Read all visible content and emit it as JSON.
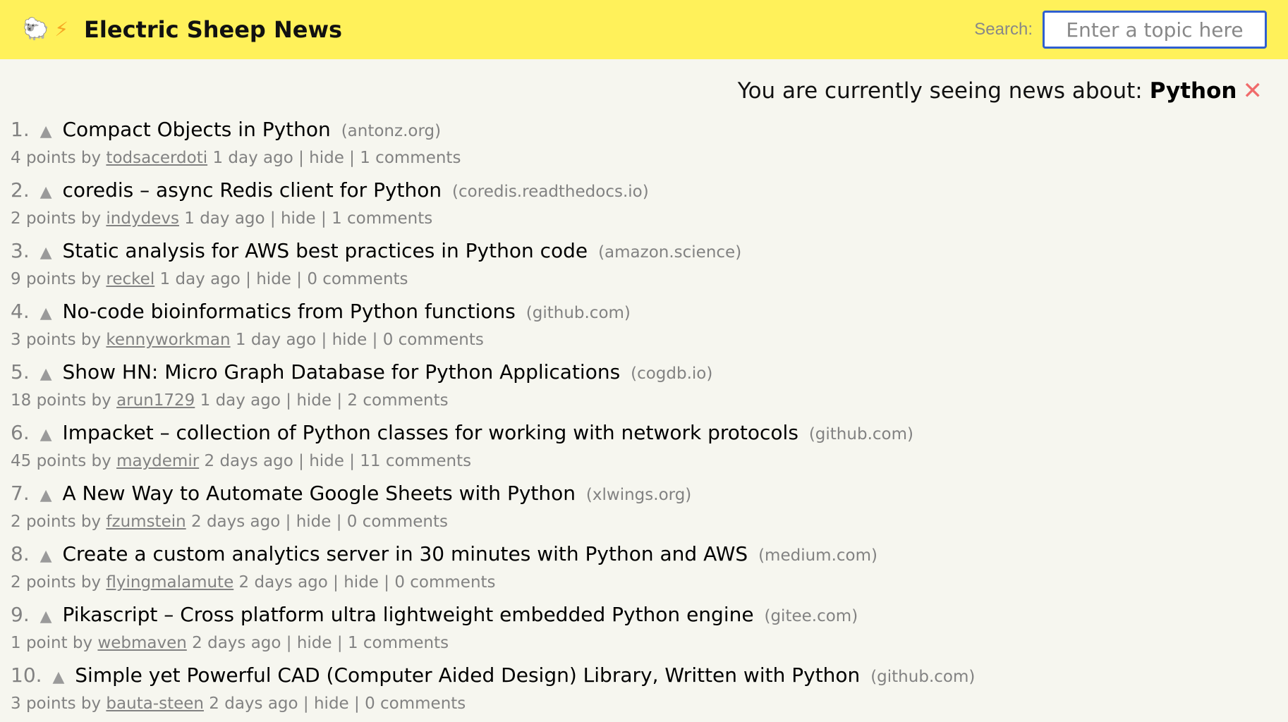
{
  "header": {
    "site_title": "Electric Sheep News",
    "icons": [
      "sheep-icon",
      "lightning-bolt-icon"
    ],
    "background_color": "#fff15a",
    "search_label": "Search:",
    "search_placeholder": "Enter a topic here"
  },
  "topic": {
    "prefix": "You are currently seeing news about:",
    "name": "Python",
    "close_icon": "close-icon",
    "close_color": "#f06b6b"
  },
  "stories": [
    {
      "rank": "1.",
      "title": "Compact Objects in Python",
      "domain": "(antonz.org)",
      "points": "4 points by",
      "author": "todsacerdoti",
      "age": "1 day ago",
      "hide": "hide",
      "comments": "1 comments"
    },
    {
      "rank": "2.",
      "title": "coredis – async Redis client for Python",
      "domain": "(coredis.readthedocs.io)",
      "points": "2 points by",
      "author": "indydevs",
      "age": "1 day ago",
      "hide": "hide",
      "comments": "1 comments"
    },
    {
      "rank": "3.",
      "title": "Static analysis for AWS best practices in Python code",
      "domain": "(amazon.science)",
      "points": "9 points by",
      "author": "reckel",
      "age": "1 day ago",
      "hide": "hide",
      "comments": "0 comments"
    },
    {
      "rank": "4.",
      "title": "No-code bioinformatics from Python functions",
      "domain": "(github.com)",
      "points": "3 points by",
      "author": "kennyworkman",
      "age": "1 day ago",
      "hide": "hide",
      "comments": "0 comments"
    },
    {
      "rank": "5.",
      "title": "Show HN: Micro Graph Database for Python Applications",
      "domain": "(cogdb.io)",
      "points": "18 points by",
      "author": "arun1729",
      "age": "1 day ago",
      "hide": "hide",
      "comments": "2 comments"
    },
    {
      "rank": "6.",
      "title": "Impacket – collection of Python classes for working with network protocols",
      "domain": "(github.com)",
      "points": "45 points by",
      "author": "maydemir",
      "age": "2 days ago",
      "hide": "hide",
      "comments": "11 comments"
    },
    {
      "rank": "7.",
      "title": "A New Way to Automate Google Sheets with Python",
      "domain": "(xlwings.org)",
      "points": "2 points by",
      "author": "fzumstein",
      "age": "2 days ago",
      "hide": "hide",
      "comments": "0 comments"
    },
    {
      "rank": "8.",
      "title": "Create a custom analytics server in 30 minutes with Python and AWS",
      "domain": "(medium.com)",
      "points": "2 points by",
      "author": "flyingmalamute",
      "age": "2 days ago",
      "hide": "hide",
      "comments": "0 comments"
    },
    {
      "rank": "9.",
      "title": "Pikascript – Cross platform ultra lightweight embedded Python engine",
      "domain": "(gitee.com)",
      "points": "1 point by",
      "author": "webmaven",
      "age": "2 days ago",
      "hide": "hide",
      "comments": "1 comments"
    },
    {
      "rank": "10.",
      "title": "Simple yet Powerful CAD (Computer Aided Design) Library, Written with Python",
      "domain": "(github.com)",
      "points": "3 points by",
      "author": "bauta-steen",
      "age": "2 days ago",
      "hide": "hide",
      "comments": "0 comments"
    }
  ]
}
